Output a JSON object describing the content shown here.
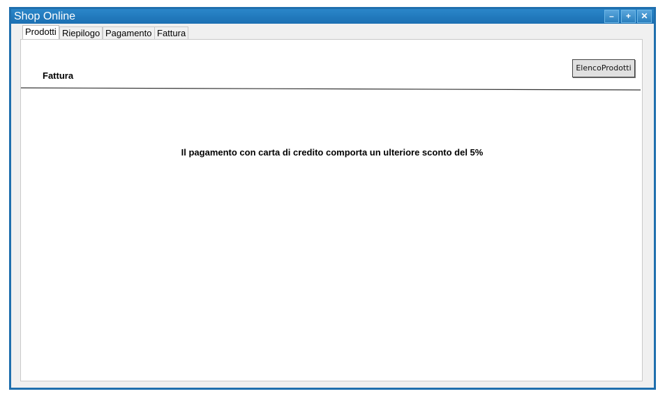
{
  "window": {
    "title": "Shop Online",
    "controls": {
      "minimize_icon": "–",
      "maximize_icon": "+",
      "close_icon": "✕"
    }
  },
  "tabs": [
    {
      "label": "Prodotti",
      "active": true
    },
    {
      "label": "Riepilogo",
      "active": false
    },
    {
      "label": "Pagamento",
      "active": false
    },
    {
      "label": "Fattura",
      "active": false
    }
  ],
  "panel": {
    "section_title": "Fattura",
    "elenco_button": "ElencoProdotti",
    "message": "Il pagamento con carta di credito comporta un ulteriore sconto del 5%"
  },
  "colors": {
    "titlebar": "#1b6fb2",
    "window_border": "#1f6fae"
  }
}
